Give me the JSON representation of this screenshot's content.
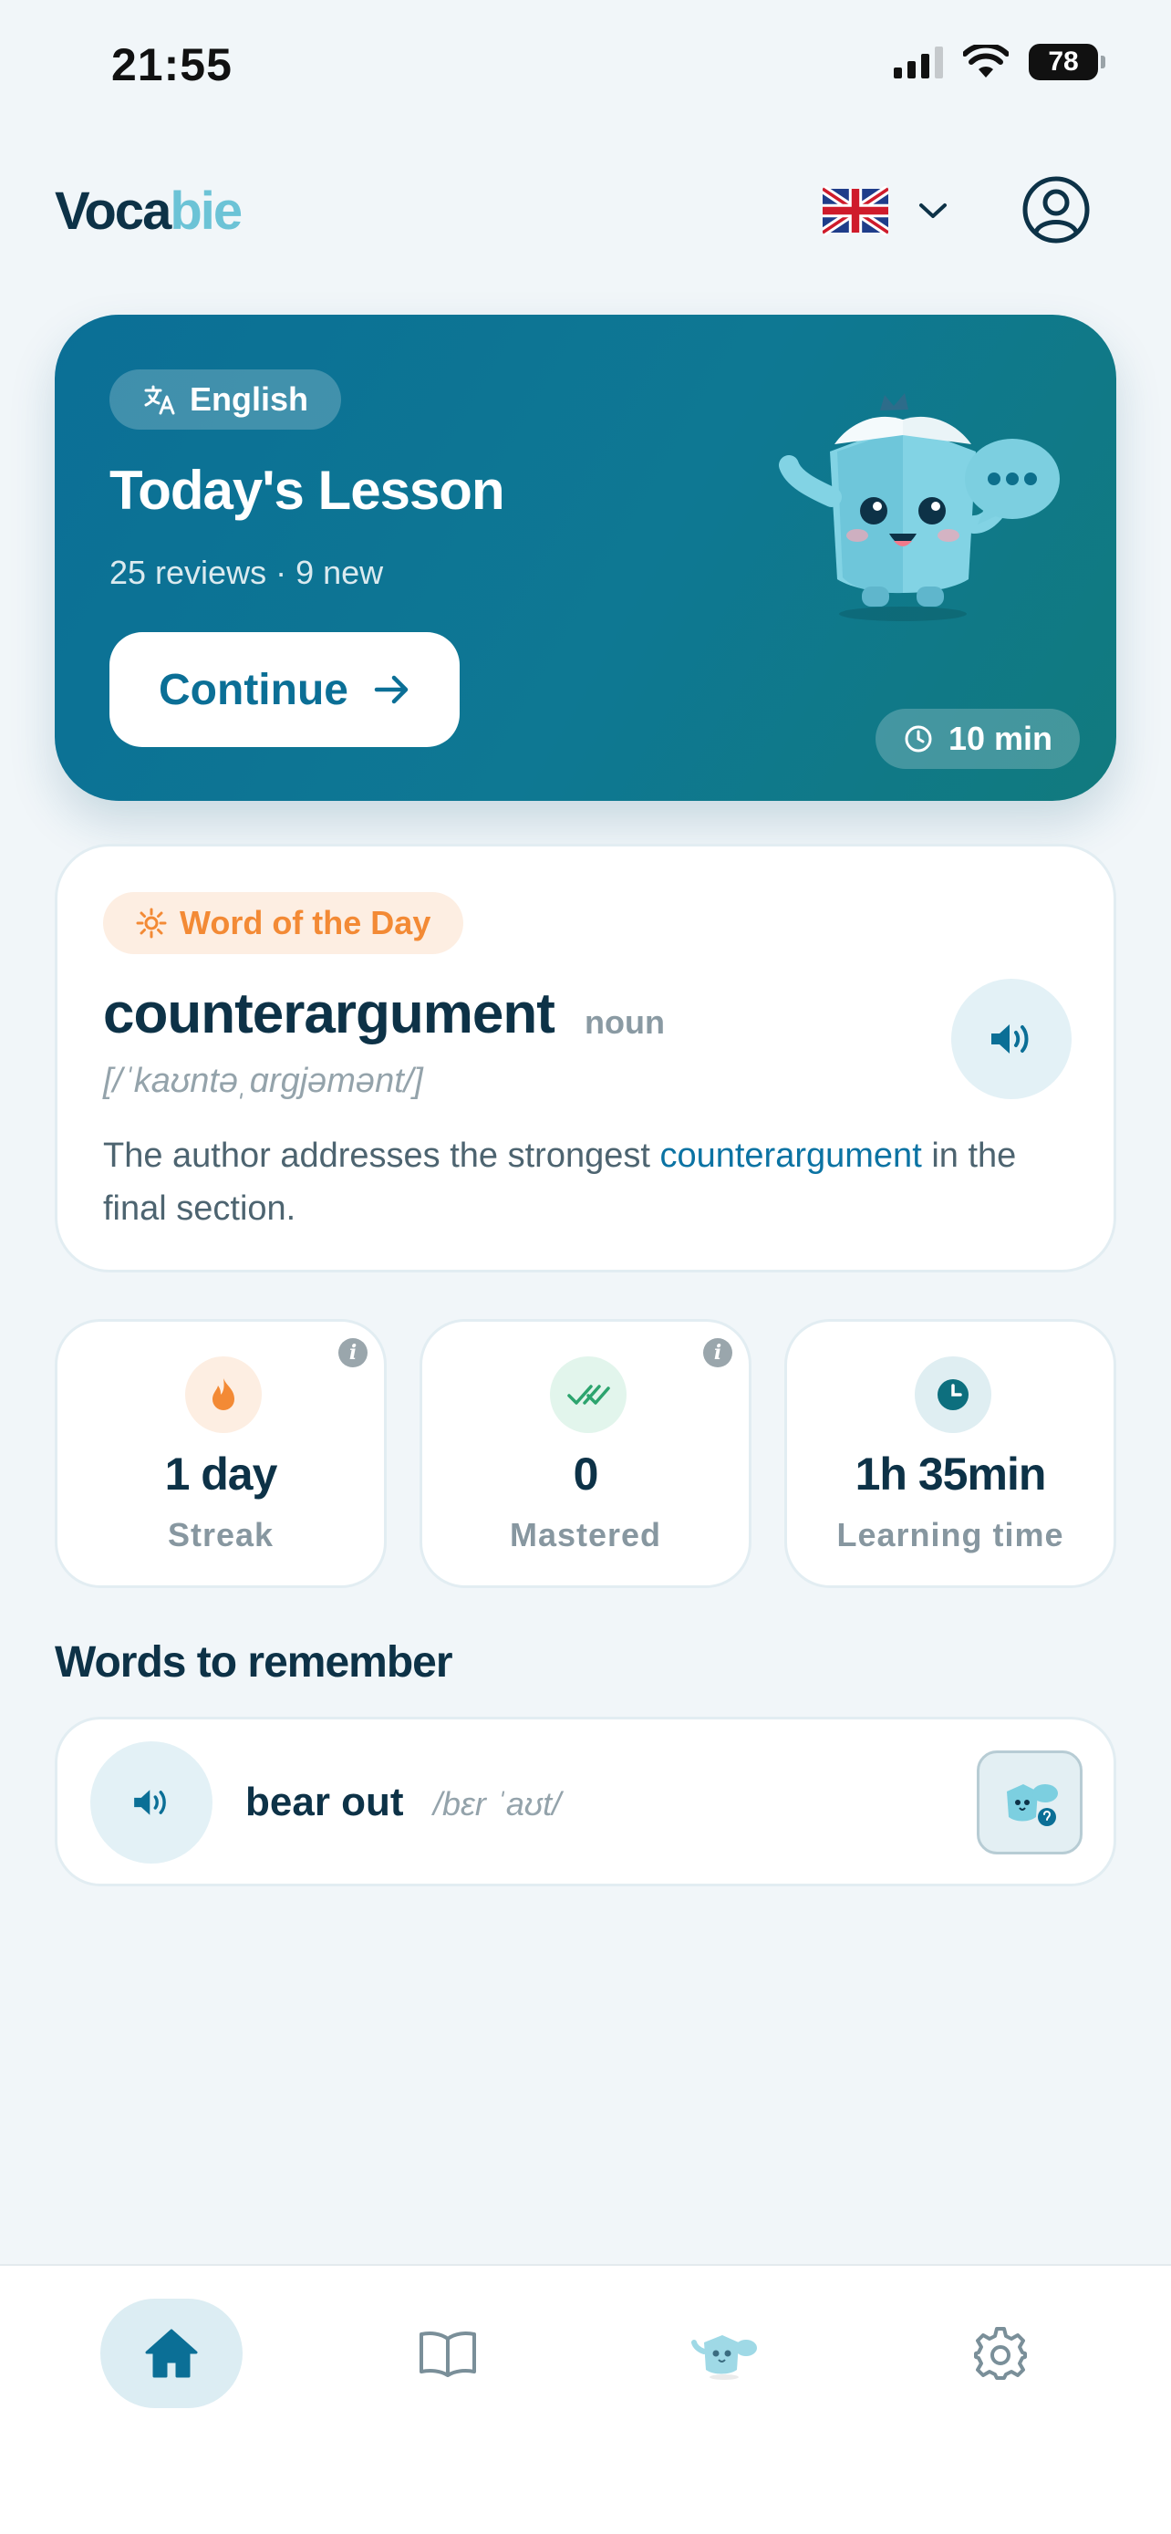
{
  "status_bar": {
    "time": "21:55",
    "battery": "78"
  },
  "header": {
    "logo_part1": "Voca",
    "logo_part2": "bie"
  },
  "lesson": {
    "language": "English",
    "title": "Today's Lesson",
    "subtitle": "25 reviews · 9 new",
    "continue_label": "Continue",
    "duration": "10 min"
  },
  "word_of_day": {
    "badge": "Word of the Day",
    "word": "counterargument",
    "part_of_speech": "noun",
    "pronunciation": "[/ˈkaʊntəˌɑrgjəmənt/]",
    "example_before": "The author addresses the strongest ",
    "example_highlight": "counterargument",
    "example_after": " in the final section."
  },
  "stats": [
    {
      "value": "1 day",
      "label": "Streak"
    },
    {
      "value": "0",
      "label": "Mastered"
    },
    {
      "value": "1h 35min",
      "label": "Learning time"
    }
  ],
  "words_to_remember": {
    "title": "Words to remember",
    "items": [
      {
        "word": "bear out",
        "pronunciation": "/bɛr ˈaʊt/"
      }
    ]
  },
  "nav": [
    "home-icon",
    "book-icon",
    "mascot-icon",
    "gear-icon"
  ],
  "colors": {
    "primary": "#0b6f96",
    "accent_orange": "#f38a35",
    "dark_text": "#0d3247"
  }
}
